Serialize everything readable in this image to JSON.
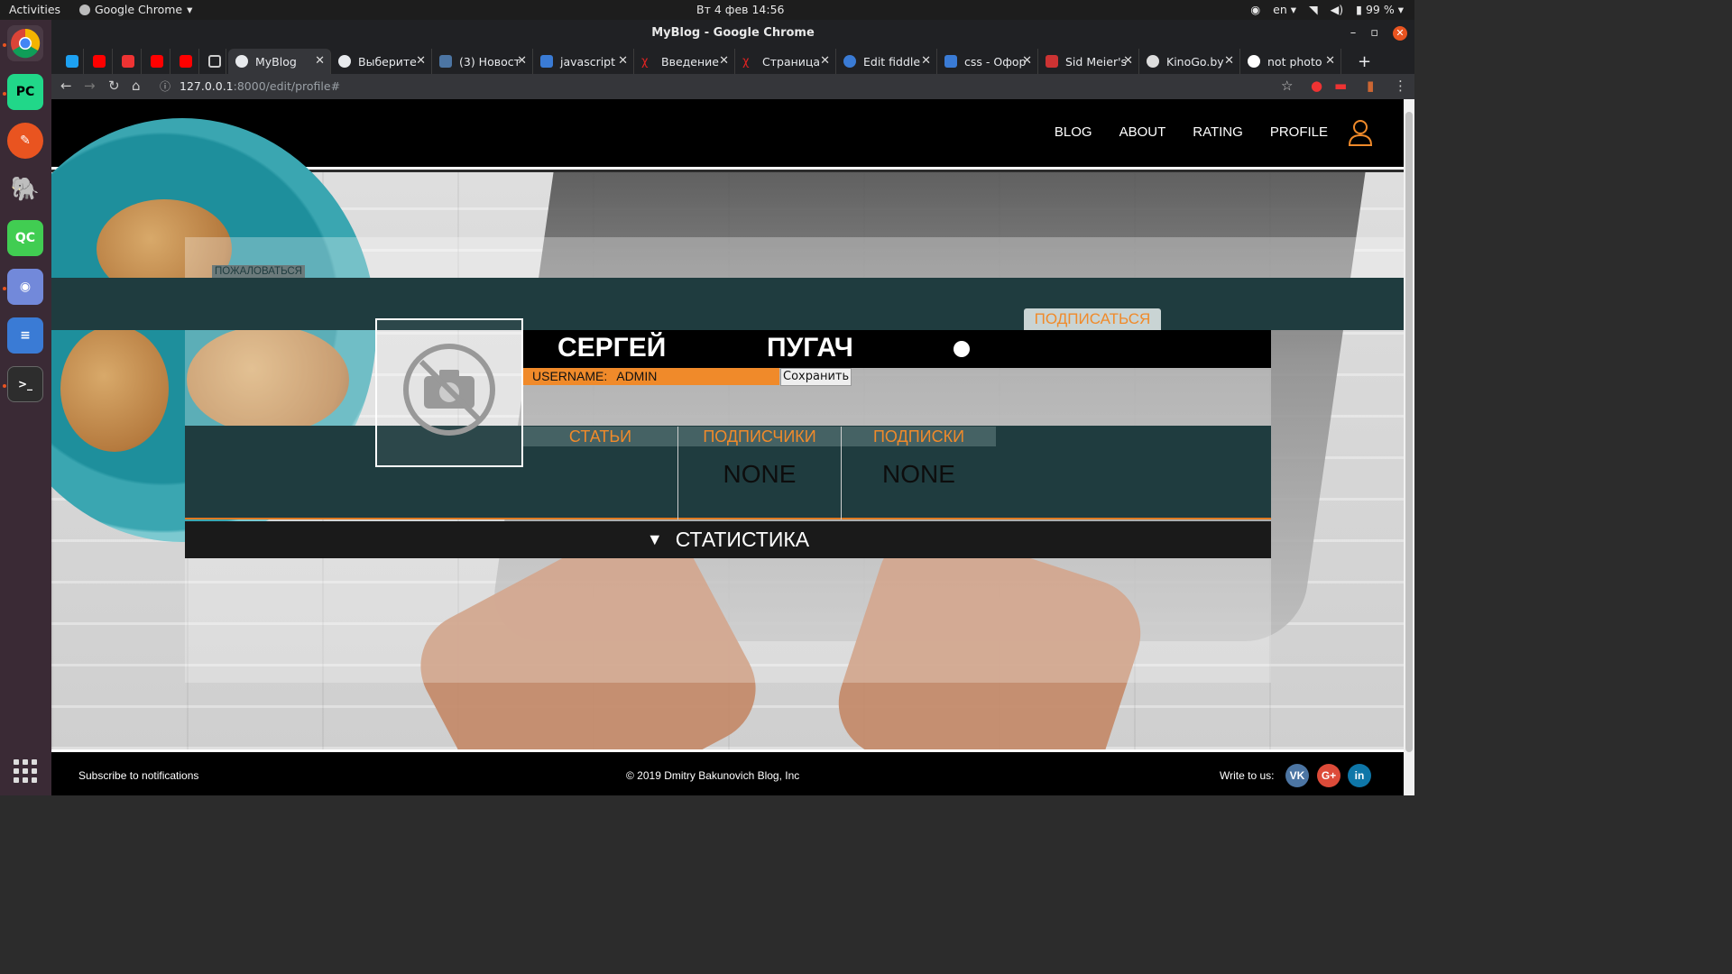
{
  "system": {
    "activities": "Activities",
    "app_name": "Google Chrome",
    "clock": "Вт 4 фев  14:56",
    "lang": "en",
    "battery": "99 %"
  },
  "window": {
    "title": "MyBlog - Google Chrome"
  },
  "tabs": [
    {
      "label": "MyBlog",
      "color": "#e8eaed"
    },
    {
      "label": "Выберите",
      "color": "#e8eaed"
    },
    {
      "label": "(3) Новост",
      "color": "#4c75a3"
    },
    {
      "label": "javascript",
      "color": "#3a7bd5"
    },
    {
      "label": "Введение",
      "color": "#d22"
    },
    {
      "label": "Страница",
      "color": "#d22"
    },
    {
      "label": "Edit fiddle",
      "color": "#3a7bd5"
    },
    {
      "label": "css - Офор",
      "color": "#3a7bd5"
    },
    {
      "label": "Sid Meier's",
      "color": "#c33"
    },
    {
      "label": "KinoGo.by",
      "color": "#ddd"
    },
    {
      "label": "not photo",
      "color": "#ddd"
    }
  ],
  "address": {
    "host": "127.0.0.1",
    "path": ":8000/edit/profile#"
  },
  "nav": {
    "blog": "BLOG",
    "about": "ABOUT",
    "rating": "RATING",
    "profile": "PROFILE"
  },
  "profile": {
    "report_label": "ПОЖАЛОВАТЬСЯ",
    "subscribe_label": "ПОДПИСАТЬСЯ",
    "first_name": "СЕРГЕЙ",
    "last_name": "ПУГАЧ",
    "username_label": "USERNAME:",
    "username_value": "ADMIN",
    "save_label": "Сохранить",
    "columns": [
      {
        "title": "СТАТЬИ",
        "value": ""
      },
      {
        "title": "ПОДПИСЧИКИ",
        "value": "NONE"
      },
      {
        "title": "ПОДПИСКИ",
        "value": "NONE"
      }
    ],
    "stats_label": "СТАТИСТИКА"
  },
  "footer": {
    "subscribe": "Subscribe to notifications",
    "copyright": "© 2019 Dmitry Bakunovich Blog, Inc",
    "write_to_us": "Write to us:",
    "vk": "VK",
    "gplus": "G+",
    "linkedin": "in"
  },
  "colors": {
    "accent": "#f08a2a",
    "panel": "#1f3c3f",
    "vk": "#4c75a3",
    "gplus": "#dd4b39",
    "linkedin": "#0e76a8"
  }
}
